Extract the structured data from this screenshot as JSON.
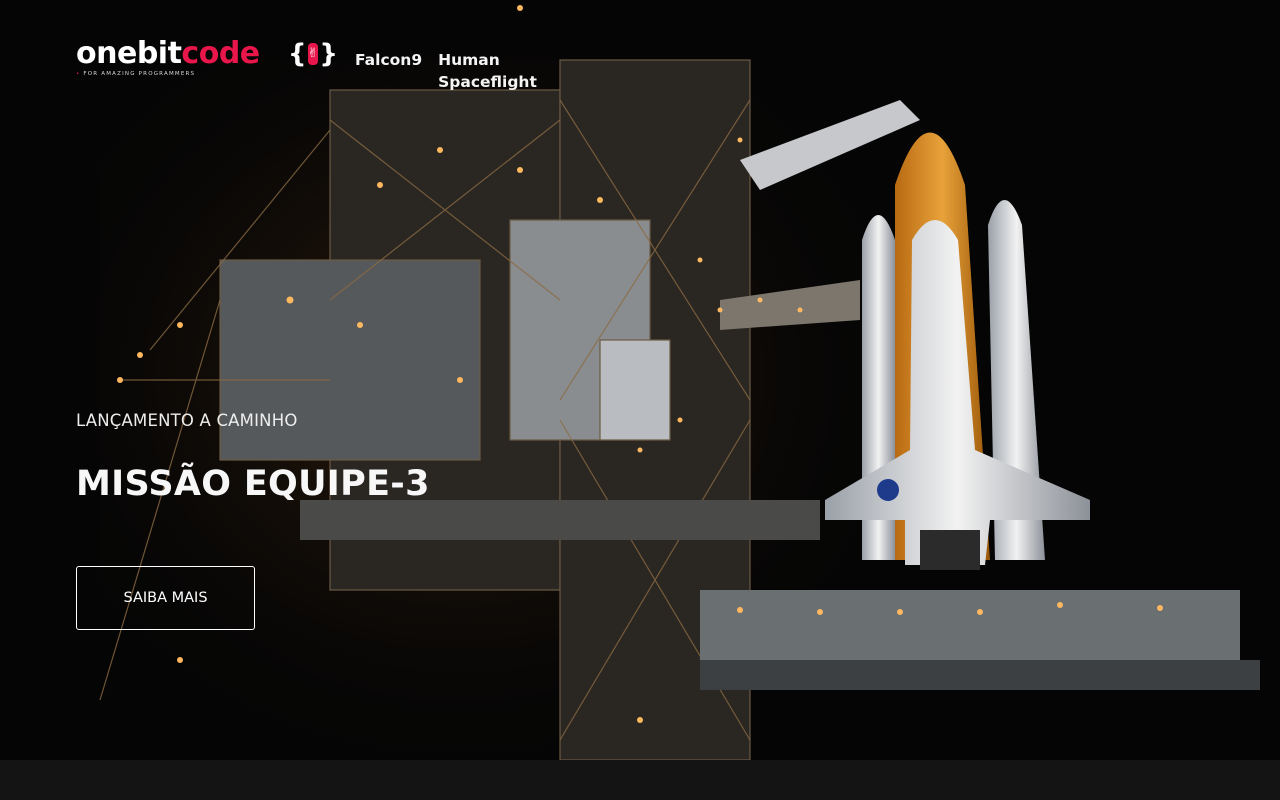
{
  "header": {
    "logo": {
      "word_main": "onebit",
      "word_accent": "code",
      "brace_open": "{",
      "brace_close": "}",
      "tagline_dot": "•",
      "tagline": "FOR AMAZING PROGRAMMERS"
    },
    "nav": [
      {
        "label": "Falcon9"
      },
      {
        "label": "Human Spaceflight"
      }
    ]
  },
  "hero": {
    "eyebrow": "LANÇAMENTO A CAMINHO",
    "title": "MISSÃO EQUIPE-3",
    "cta_label": "SAIBA MAIS",
    "background": "space-shuttle-launch-pad-night-photo"
  },
  "colors": {
    "brand_accent": "#e8164a",
    "text": "#ffffff",
    "background": "#050505"
  }
}
